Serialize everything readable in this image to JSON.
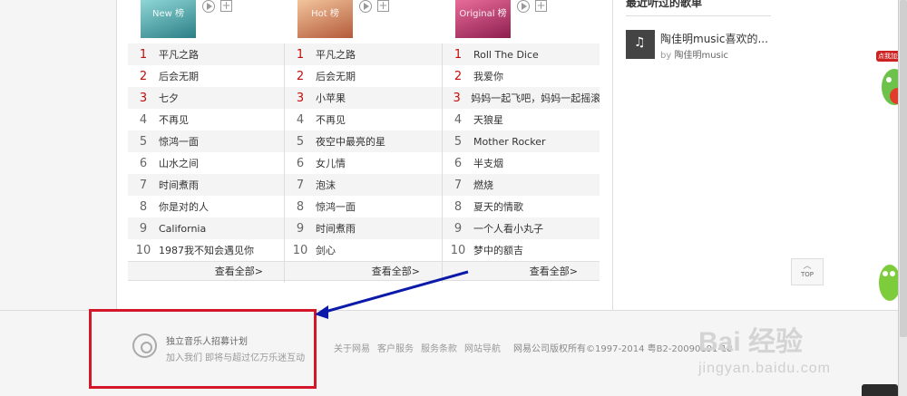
{
  "charts": [
    {
      "cover_text": "New 榜",
      "more_label": "查看全部>",
      "songs": [
        "平凡之路",
        "后会无期",
        "七夕",
        "不再见",
        "惊鸿一面",
        "山水之间",
        "时间煮雨",
        "你是对的人",
        "California",
        "1987我不知会遇见你"
      ]
    },
    {
      "cover_text": "Hot 榜",
      "more_label": "查看全部>",
      "songs": [
        "平凡之路",
        "后会无期",
        "小苹果",
        "不再见",
        "夜空中最亮的星",
        "女儿情",
        "泡沫",
        "惊鸿一面",
        "时间煮雨",
        "剑心"
      ]
    },
    {
      "cover_text": "Original 榜",
      "more_label": "查看全部>",
      "songs": [
        "Roll The Dice",
        "我爱你",
        "妈妈一起飞吧，妈妈一起摇滚吧",
        "天狼星",
        "Mother Rocker",
        "半支烟",
        "燃烧",
        "夏天的情歌",
        "一个人看小丸子",
        "梦中的额吉"
      ]
    }
  ],
  "sidebar": {
    "title": "最近听过的歌单",
    "playlist_name": "陶佳明music喜欢的...",
    "by_prefix": "by",
    "playlist_author": "陶佳明music"
  },
  "top_button": {
    "arrow": "︿",
    "label": "TOP"
  },
  "recruit": {
    "title": "独立音乐人招募计划",
    "subtitle": "加入我们 即将与超过亿万乐迷互动"
  },
  "footer": {
    "links": [
      "关于网易",
      "客户服务",
      "服务条款",
      "网站导航"
    ],
    "copyright": "网易公司版权所有©1997-2014  粤B2-20090191-18"
  },
  "watermark": {
    "brand": "Bai 经验",
    "url": "jingyan.baidu.com"
  },
  "mascot_badge": "点我加速",
  "colors": {
    "rank_top": "#c10d0c",
    "highlight_box": "#d3162a",
    "arrow": "#0b1aa8"
  }
}
